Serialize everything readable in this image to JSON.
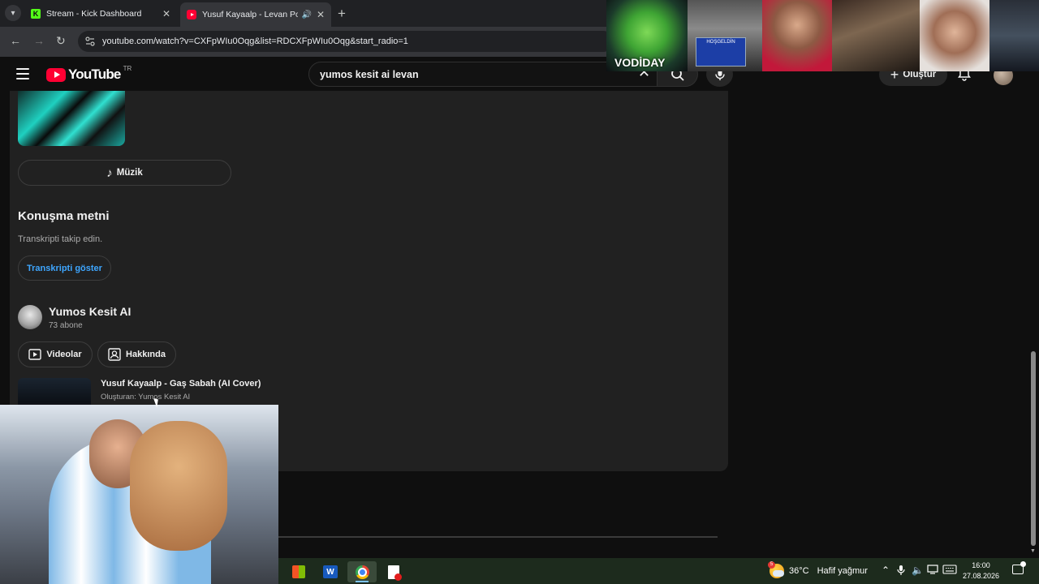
{
  "browser": {
    "tabs": [
      {
        "title": "Stream - Kick Dashboard",
        "favicon": "K"
      },
      {
        "title": "Yusuf Kayaalp - Levan Polka",
        "active": true
      }
    ],
    "url": "youtube.com/watch?v=CXFpWIu0Oqg&list=RDCXFpWIu0Oqg&start_radio=1"
  },
  "youtube": {
    "logo_text": "YouTube",
    "country_code": "TR",
    "search_value": "yumos kesit ai levan",
    "create_label": "Oluştur"
  },
  "panel": {
    "music_button": "Müzik",
    "transcript": {
      "title": "Konuşma metni",
      "subtitle": "Transkripti takip edin.",
      "button": "Transkripti göster"
    },
    "channel": {
      "name": "Yumos Kesit AI",
      "subscribers": "73 abone",
      "videos_button": "Videolar",
      "about_button": "Hakkında"
    },
    "video": {
      "title": "Yusuf Kayaalp - Gaş Sabah (AI Cover)",
      "by": "Oluşturan: Yumos Kesit AI"
    }
  },
  "overlays": {
    "webcam_label": "VODİDAY",
    "webcam_badge": "HOŞGELDİN"
  },
  "taskbar": {
    "weather_temp": "36°C",
    "weather_desc": "Hafif yağmur",
    "weather_alert": "5",
    "time": "16:00",
    "date": "27.08.2026"
  },
  "colors": {
    "background": "#0f0f0f",
    "panel": "#212121",
    "link_blue": "#3ea6ff",
    "youtube_red": "#ff0033",
    "taskbar": "#1d2b1d"
  }
}
